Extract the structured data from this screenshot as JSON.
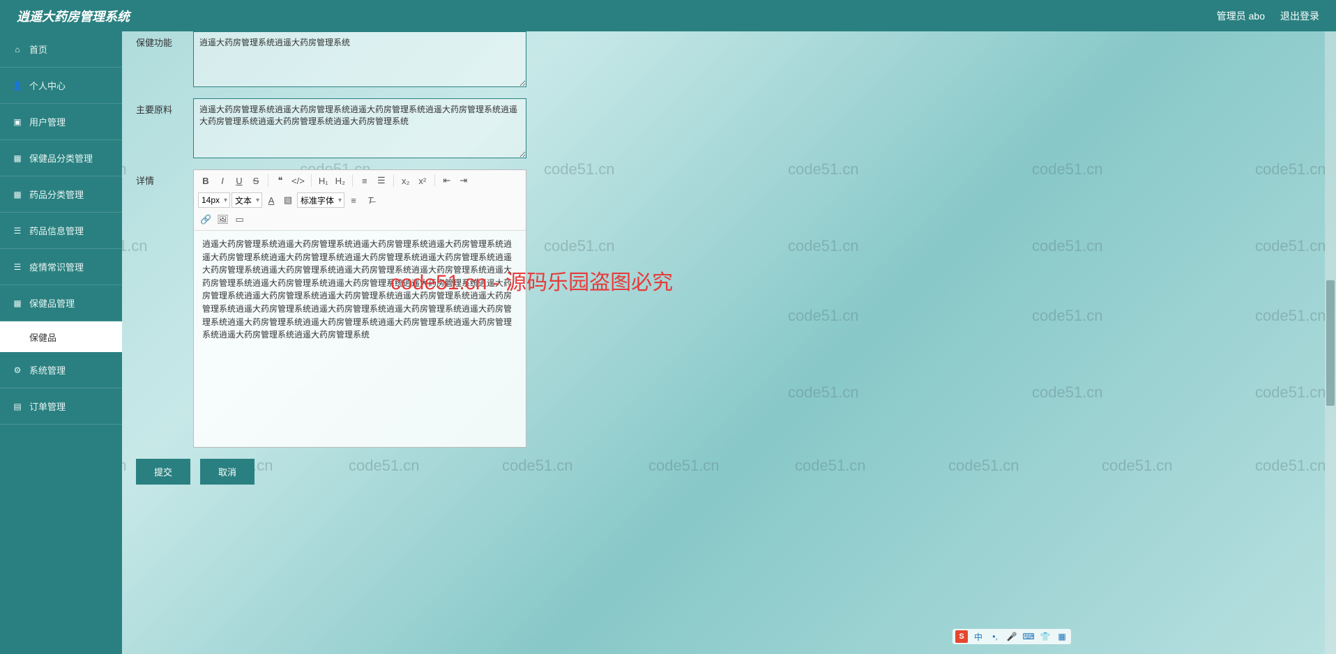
{
  "header": {
    "title": "逍遥大药房管理系统",
    "admin_label": "管理员 abo",
    "logout_label": "退出登录"
  },
  "sidebar": {
    "items": [
      {
        "icon": "home",
        "label": "首页"
      },
      {
        "icon": "user",
        "label": "个人中心"
      },
      {
        "icon": "users",
        "label": "用户管理"
      },
      {
        "icon": "grid",
        "label": "保健品分类管理"
      },
      {
        "icon": "grid",
        "label": "药品分类管理"
      },
      {
        "icon": "list",
        "label": "药品信息管理"
      },
      {
        "icon": "list",
        "label": "疫情常识管理"
      },
      {
        "icon": "grid",
        "label": "保健品管理"
      },
      {
        "icon": "gear",
        "label": "系统管理"
      },
      {
        "icon": "list",
        "label": "订单管理"
      }
    ],
    "sub_item": "保健品"
  },
  "form": {
    "field1": {
      "label": "保健功能",
      "value": "逍遥大药房管理系统逍遥大药房管理系统"
    },
    "field2": {
      "label": "主要原料",
      "value": "逍遥大药房管理系统逍遥大药房管理系统逍遥大药房管理系统逍遥大药房管理系统逍遥大药房管理系统逍遥大药房管理系统逍遥大药房管理系统"
    },
    "field3": {
      "label": "详情",
      "content": "逍遥大药房管理系统逍遥大药房管理系统逍遥大药房管理系统逍遥大药房管理系统逍遥大药房管理系统逍遥大药房管理系统逍遥大药房管理系统逍遥大药房管理系统逍遥大药房管理系统逍遥大药房管理系统逍遥大药房管理系统逍遥大药房管理系统逍遥大药房管理系统逍遥大药房管理系统逍遥大药房管理系统逍遥大药房管理系统逍遥大药房管理系统逍遥大药房管理系统逍遥大药房管理系统逍遥大药房管理系统逍遥大药房管理系统逍遥大药房管理系统逍遥大药房管理系统逍遥大药房管理系统逍遥大药房管理系统逍遥大药房管理系统逍遥大药房管理系统逍遥大药房管理系统逍遥大药房管理系统逍遥大药房管理系统逍遥大药房管理系统"
    }
  },
  "editor_toolbar": {
    "font_size": "14px",
    "paragraph": "文本",
    "font_family": "标准字体"
  },
  "actions": {
    "submit": "提交",
    "cancel": "取消"
  },
  "overlay": {
    "text": "code51.cn - 源码乐园盗图必究",
    "watermark": "code51.cn"
  },
  "ime": {
    "logo": "S",
    "lang": "中"
  }
}
